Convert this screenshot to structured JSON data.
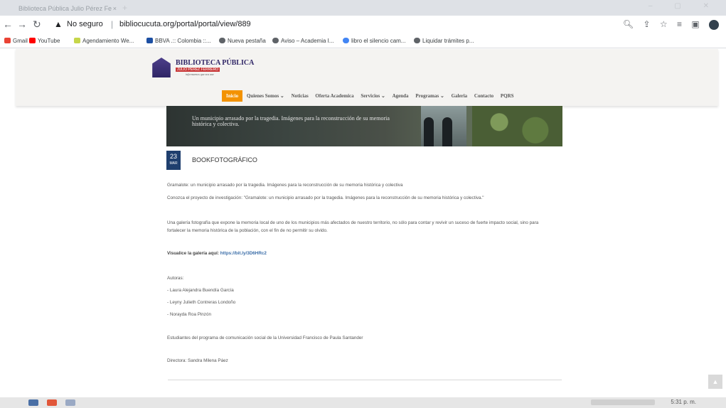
{
  "browser": {
    "tab_title": "Biblioteca Pública Julio Pérez Fe",
    "tab_close": "×",
    "new_tab": "+",
    "window_controls": "–  ▢  ✕",
    "security_label": "No seguro",
    "url_host": "bibliocucuta.org",
    "url_path": "/portal/portal/view/889"
  },
  "bookmarks": [
    {
      "label": "Gmail",
      "icon": "gmail-icon",
      "color": "#ea4335"
    },
    {
      "label": "YouTube",
      "icon": "youtube-icon",
      "color": "#ff0000"
    },
    {
      "label": "Agendamiento We...",
      "icon": "bookmark-icon",
      "color": "#c6d64a"
    },
    {
      "label": "BBVA .:: Colombia ::...",
      "icon": "bbva-icon",
      "color": "#1c4fa3"
    },
    {
      "label": "Nueva pestaña",
      "icon": "globe-icon",
      "color": "#5f6368"
    },
    {
      "label": "Aviso – Academia I...",
      "icon": "globe-icon",
      "color": "#5f6368"
    },
    {
      "label": "libro el silencio cam...",
      "icon": "google-icon",
      "color": "#4285f4"
    },
    {
      "label": "Liquidar trámites p...",
      "icon": "globe-icon",
      "color": "#5f6368"
    }
  ],
  "site": {
    "logo_title": "BIBLIOTECA PÚBLICA",
    "logo_subtitle": "JULIO PÉREZ FERRERO",
    "logo_tagline": "informarnos que nos une",
    "nav": [
      "Inicio",
      "Quienes Somos ⌄",
      "Noticias",
      "Oferta Academica",
      "Servicios ⌄",
      "Agenda",
      "Programas ⌄",
      "Galeria",
      "Contacto",
      "PQRS"
    ],
    "accent_color": "#f39200"
  },
  "hero": {
    "caption": "Un municipio arrasado por la tragedia. Imágenes para la reconstrucción de su memoria histórica y colectiva."
  },
  "post": {
    "day": "23",
    "month": "MAR",
    "title": "BOOKFOTOGRÁFICO",
    "p1": "Gramalote: un municipio arrasado por la tragedia. Imágenes para la reconstrucción de su memoria histórica y colectiva",
    "p2": "Conozca el proyecto de investigación:  \"Gramalote: un municipio arrasado por la tragedia.   Imágenes para la reconstrucción de su memoria histórica y colectiva.\"",
    "p3": "Una galería fotografía que expone la memoria local de uno de los municipios más afectados de nuestro territorio, no sólo para contar y revivir un suceso de fuerte impacto social, sino para fortalecer la memoria histórica de la población, con el fin de no permitir su olvido.",
    "gallery_label": "Visualice la galería aquí:",
    "gallery_link": "https://bit.ly/3D6HRc2",
    "authors_label": "Autoras:",
    "authors": [
      "- Laura Alejandra Buendía García",
      "- Leyny Julieth Contreras Londoño",
      "- Norayda Roa Pinzón"
    ],
    "students": "Estudiantes del programa de comunicación social de la Universidad Francisco de Paula Santander",
    "director": "Directora: Sandra Milena Páez"
  },
  "taskbar": {
    "clock": "5:31 p. m."
  }
}
